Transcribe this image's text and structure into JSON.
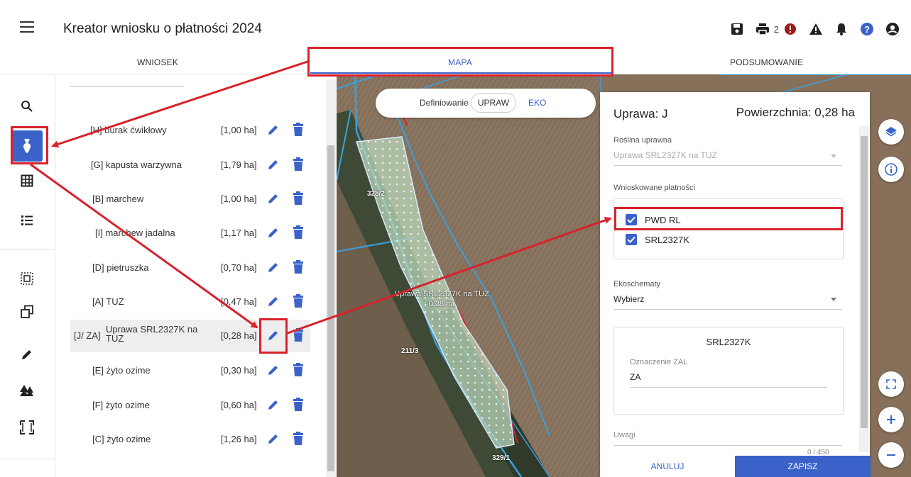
{
  "app": {
    "title": "Kreator wniosku o płatności 2024",
    "warning_count": "2"
  },
  "icons": {
    "menu": "hamburger-icon",
    "save": "save-icon",
    "print": "print-icon",
    "error": "error-circle-icon",
    "warning": "warning-triangle-icon",
    "bell": "bell-icon",
    "help": "help-icon",
    "account": "account-icon"
  },
  "tabs": [
    {
      "label": "WNIOSEK",
      "active": false
    },
    {
      "label": "MAPA",
      "active": true
    },
    {
      "label": "PODSUMOWANIE",
      "active": false
    }
  ],
  "rail": [
    "search-icon",
    "crop-icon",
    "grid-icon",
    "list-icon",
    "select-area-icon",
    "copy-icon",
    "pencil-icon",
    "trees-icon",
    "frame-icon"
  ],
  "crops": [
    {
      "label": "[H] burak ćwikłowy",
      "area": "[1,00 ha]"
    },
    {
      "label": "[G] kapusta warzywna",
      "area": "[1,79 ha]"
    },
    {
      "label": "[B] marchew",
      "area": "[1,00 ha]"
    },
    {
      "label": "[I] marchew jadalna",
      "area": "[1,17 ha]"
    },
    {
      "label": "[D] pietruszka",
      "area": "[0,70 ha]"
    },
    {
      "label": "[A] TUZ",
      "area": "[0,47 ha]"
    },
    {
      "label_prefix": "[J/ ZA]",
      "label_main": "Uprawa SRL2327K na TUZ",
      "area": "[0,28 ha]",
      "selected": true
    },
    {
      "label": "[E] żyto ozime",
      "area": "[0,30 ha]"
    },
    {
      "label": "[F] żyto ozime",
      "area": "[0,60 ha]"
    },
    {
      "label": "[C] żyto ozime",
      "area": "[1,26 ha]"
    }
  ],
  "map": {
    "toggle_label": "Definiowanie",
    "toggle_upraw": "UPRAW",
    "toggle_eko": "EKO",
    "parcels": [
      "328/2",
      "211/3",
      "329/1"
    ],
    "crop_name": "Uprawa SRL2327K na TUZ",
    "crop_area": "0,28 ha"
  },
  "form": {
    "title": "Uprawa: J",
    "area": "Powierzchnia: 0,28 ha",
    "plant_label": "Roślina uprawna",
    "plant_value": "Uprawa SRL2327K na TUZ",
    "payments_label": "Wnioskowane płatności",
    "payments": [
      {
        "label": "PWD RL",
        "checked": true
      },
      {
        "label": "SRL2327K",
        "checked": true
      }
    ],
    "eco_label": "Ekoschematy",
    "eco_value": "Wybierz",
    "card_title": "SRL2327K",
    "zal_label": "Oznaczenie ZAL",
    "zal_value": "ZA",
    "notes_label": "Uwagi",
    "notes_counter": "0 / 450",
    "cancel": "ANULUJ",
    "save": "ZAPISZ"
  },
  "colors": {
    "accent": "#3a62c9",
    "annotation": "#d8222c"
  }
}
